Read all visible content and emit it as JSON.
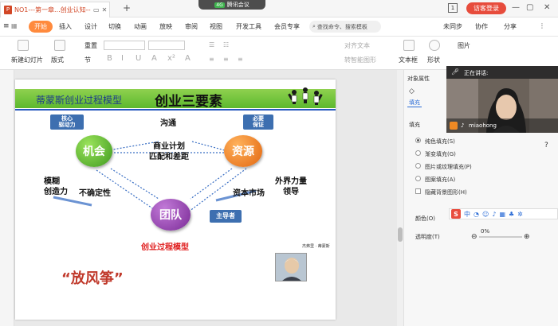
{
  "titlebar": {
    "tab_title": "NO1---第一章...创业认知----第",
    "meeting_label": "腾讯会议",
    "signal_label": "4G",
    "login_label": "访客登录",
    "page_indicator": "1"
  },
  "menu": {
    "start": "开始",
    "items": [
      "插入",
      "设计",
      "切换",
      "动画",
      "放映",
      "审阅",
      "视图",
      "开发工具",
      "会员专享"
    ],
    "search_placeholder": "查找命令、搜索模板",
    "sync_label": "未同步",
    "collab_label": "协作",
    "share_label": "分享"
  },
  "ribbon": {
    "new_slide": "新建幻灯片",
    "layout": "版式",
    "reset": "重置",
    "section": "节",
    "textbox": "文本框",
    "shape": "形状",
    "align_text": "对齐文本",
    "smartart": "转智能图形",
    "picture": "图片"
  },
  "slide": {
    "title_small": "蒂蒙斯创业过程模型",
    "title_big": "创业三要素",
    "callout_core": [
      "核心",
      "驱动力"
    ],
    "callout_need": [
      "必要",
      "保证"
    ],
    "communication": "沟通",
    "center_text": [
      "商业计划",
      "匹配和差距"
    ],
    "opportunity": "机会",
    "resource": "资源",
    "team": "团队",
    "fuzzy": [
      "模糊",
      "创造力"
    ],
    "uncertainty": "不确定性",
    "capital_market": "资本市场",
    "external": [
      "外界力量",
      "领导"
    ],
    "leader": "主导者",
    "model_caption": "创业过程模型",
    "quote": "“放风筝”",
    "portrait_caption": "杰弗里 · 蒂蒙斯"
  },
  "rightpane": {
    "object_props": "对象属性",
    "fill_tab": "填充",
    "fill_section": "填充",
    "options": [
      "纯色填充(S)",
      "渐变填充(G)",
      "图片或纹理填充(P)",
      "图案填充(A)"
    ],
    "hide_bg": "隐藏背景图形(H)",
    "color_label": "颜色(O)",
    "transparency_label": "透明度(T)",
    "transparency_value": "0%"
  },
  "video": {
    "speaking": "正在讲话:",
    "name": "miaohong"
  },
  "floatbar": {
    "brand": "S",
    "lang": "中"
  }
}
